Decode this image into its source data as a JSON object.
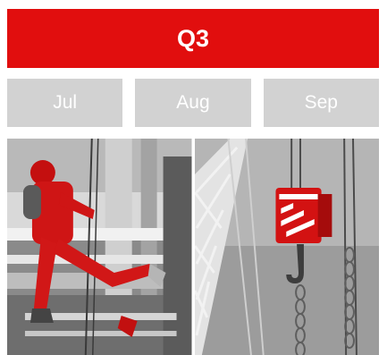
{
  "quarter": {
    "label": "Q3"
  },
  "months": [
    {
      "label": "Jul"
    },
    {
      "label": "Aug"
    },
    {
      "label": "Sep"
    }
  ],
  "colors": {
    "accent": "#e10e0e",
    "month_bg": "#d2d2d2",
    "month_text": "#ffffff"
  },
  "photos": [
    {
      "subject": "rope-access-worker-icon"
    },
    {
      "subject": "crane-hook-icon"
    }
  ]
}
